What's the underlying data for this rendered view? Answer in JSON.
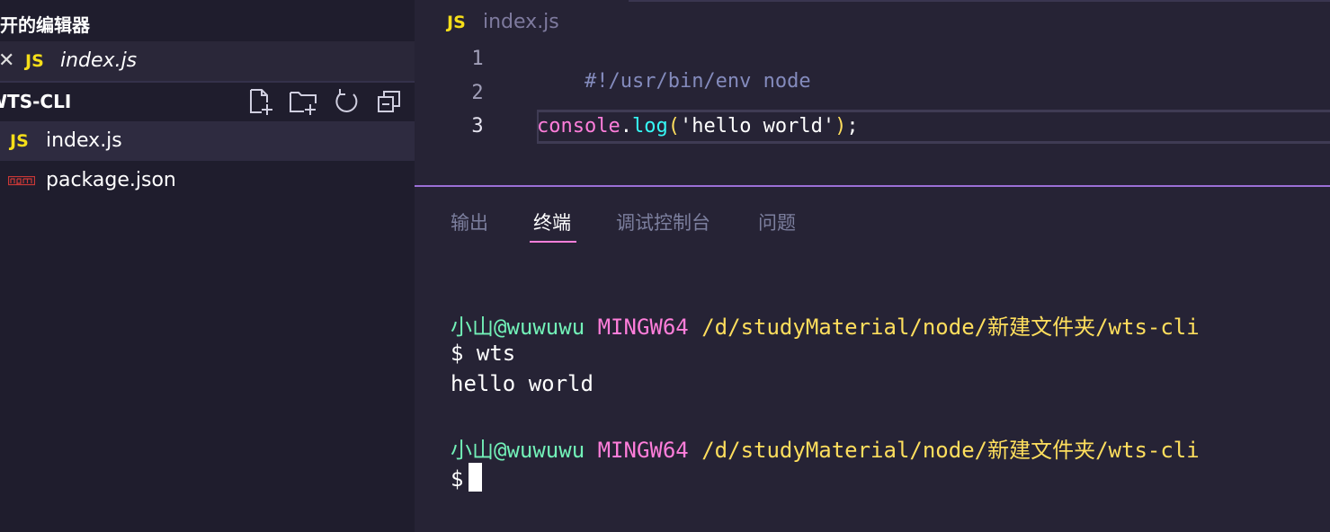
{
  "sidebar": {
    "open_editors_title": "打开的编辑器",
    "open_editor": {
      "close_glyph": "✕",
      "badge": "JS",
      "file": "index.js"
    },
    "project_title": "WTS-CLI",
    "toolbar_icons": [
      "new-file-icon",
      "new-folder-icon",
      "refresh-icon",
      "collapse-all-icon"
    ],
    "files": [
      {
        "name": "index.js",
        "badge": "JS",
        "active": true
      },
      {
        "name": "package.json",
        "icon": "npm-icon",
        "active": false
      }
    ]
  },
  "editor": {
    "tab": {
      "badge": "JS",
      "name": "index.js"
    },
    "line_numbers": [
      "1",
      "2",
      "3"
    ],
    "line1": "#!/usr/bin/env node",
    "line3": {
      "ident": "console",
      "dot": ".",
      "method": "log",
      "open_paren": "(",
      "string": "'hello world'",
      "close_paren": ")",
      "semicolon": ";"
    }
  },
  "panel": {
    "tabs": [
      "输出",
      "终端",
      "调试控制台",
      "问题"
    ],
    "active_tab": "终端",
    "terminal": {
      "user": "小山@wuwuwu",
      "host": "MINGW64",
      "path": "/d/studyMaterial/node/新建文件夹/wts-cli",
      "command_line": "$ wts",
      "output": "hello world",
      "prompt": "$"
    }
  },
  "colors": {
    "background": "#262335",
    "sidebar": "#1f1d2d",
    "accent_pink": "#ff7edb",
    "panel_border": "#9b6fd6",
    "js_yellow": "#f5de19"
  }
}
